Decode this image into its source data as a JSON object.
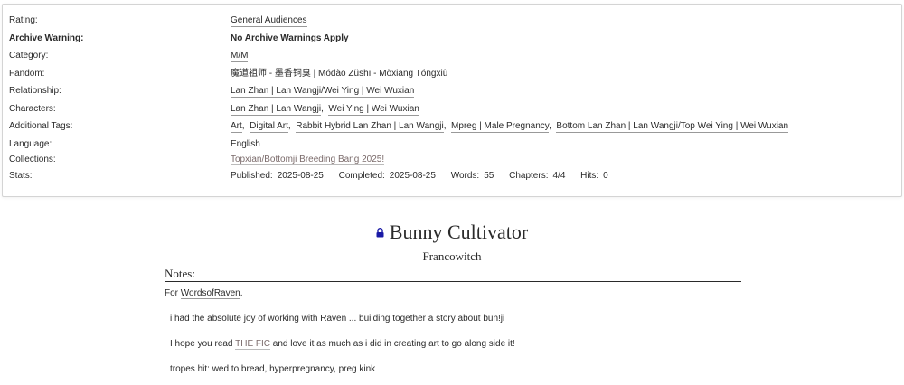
{
  "meta": {
    "rating": {
      "label": "Rating:",
      "value": "General Audiences"
    },
    "warning": {
      "label": "Archive Warning:",
      "value": "No Archive Warnings Apply"
    },
    "category": {
      "label": "Category:",
      "value": "M/M"
    },
    "fandom": {
      "label": "Fandom:",
      "value": "魔道祖师 - 墨香铜臭 | Módào Zǔshī - Mòxiāng Tóngxiù"
    },
    "relationship": {
      "label": "Relationship:",
      "value": "Lan Zhan | Lan Wangji/Wei Ying | Wei Wuxian"
    },
    "characters": {
      "label": "Characters:",
      "values": [
        "Lan Zhan | Lan Wangji",
        "Wei Ying | Wei Wuxian"
      ]
    },
    "additional_tags": {
      "label": "Additional Tags:",
      "values": [
        "Art",
        "Digital Art",
        "Rabbit Hybrid Lan Zhan | Lan Wangji",
        "Mpreg | Male Pregnancy",
        "Bottom Lan Zhan | Lan Wangji/Top Wei Ying | Wei Wuxian"
      ]
    },
    "language": {
      "label": "Language:",
      "value": "English"
    },
    "collections": {
      "label": "Collections:",
      "value": "Topxian/Bottomji Breeding Bang 2025!"
    },
    "stats": {
      "label": "Stats:",
      "published_label": "Published:",
      "published": "2025-08-25",
      "completed_label": "Completed:",
      "completed": "2025-08-25",
      "words_label": "Words:",
      "words": "55",
      "chapters_label": "Chapters:",
      "chapters": "4/4",
      "hits_label": "Hits:",
      "hits": "0"
    }
  },
  "work": {
    "title": "Bunny Cultivator",
    "author": "Francowitch",
    "lock_icon": "lock-icon",
    "lock_color": "#1a1aa6"
  },
  "notes": {
    "heading": "Notes:",
    "for_prefix": "For",
    "for_link": "WordsofRaven",
    "for_suffix": ".",
    "line1_prefix": "i had the absolute joy of working with",
    "line1_link": "Raven",
    "line1_suffix": "... building together a story about bun!ji",
    "line2_prefix": "I hope you read",
    "line2_link": "THE FIC",
    "line2_suffix": "and love it as much as i did in creating art to go along side it!",
    "line3": "tropes hit: wed to bread, hyperpregnancy, preg kink"
  }
}
